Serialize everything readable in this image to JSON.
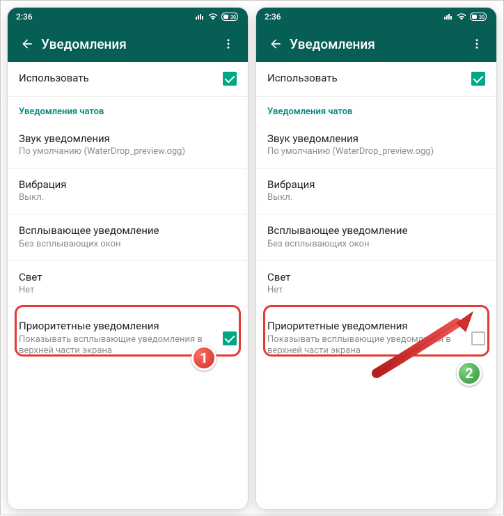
{
  "status": {
    "time": "2:36"
  },
  "appbar": {
    "title": "Уведомления"
  },
  "use": {
    "label": "Использовать"
  },
  "section": {
    "chats": "Уведомления чатов"
  },
  "sound": {
    "label": "Звук уведомления",
    "value": "По умолчанию (WaterDrop_preview.ogg)"
  },
  "vibration": {
    "label": "Вибрация",
    "value": "Выкл."
  },
  "popup": {
    "label": "Всплывающее уведомление",
    "value": "Без всплывающих окон"
  },
  "light": {
    "label": "Свет",
    "value": "Нет"
  },
  "priority": {
    "label": "Приоритетные уведомления",
    "desc": "Показывать всплывающие уведомления в верхней части экрана"
  },
  "badge1": "1",
  "badge2": "2"
}
